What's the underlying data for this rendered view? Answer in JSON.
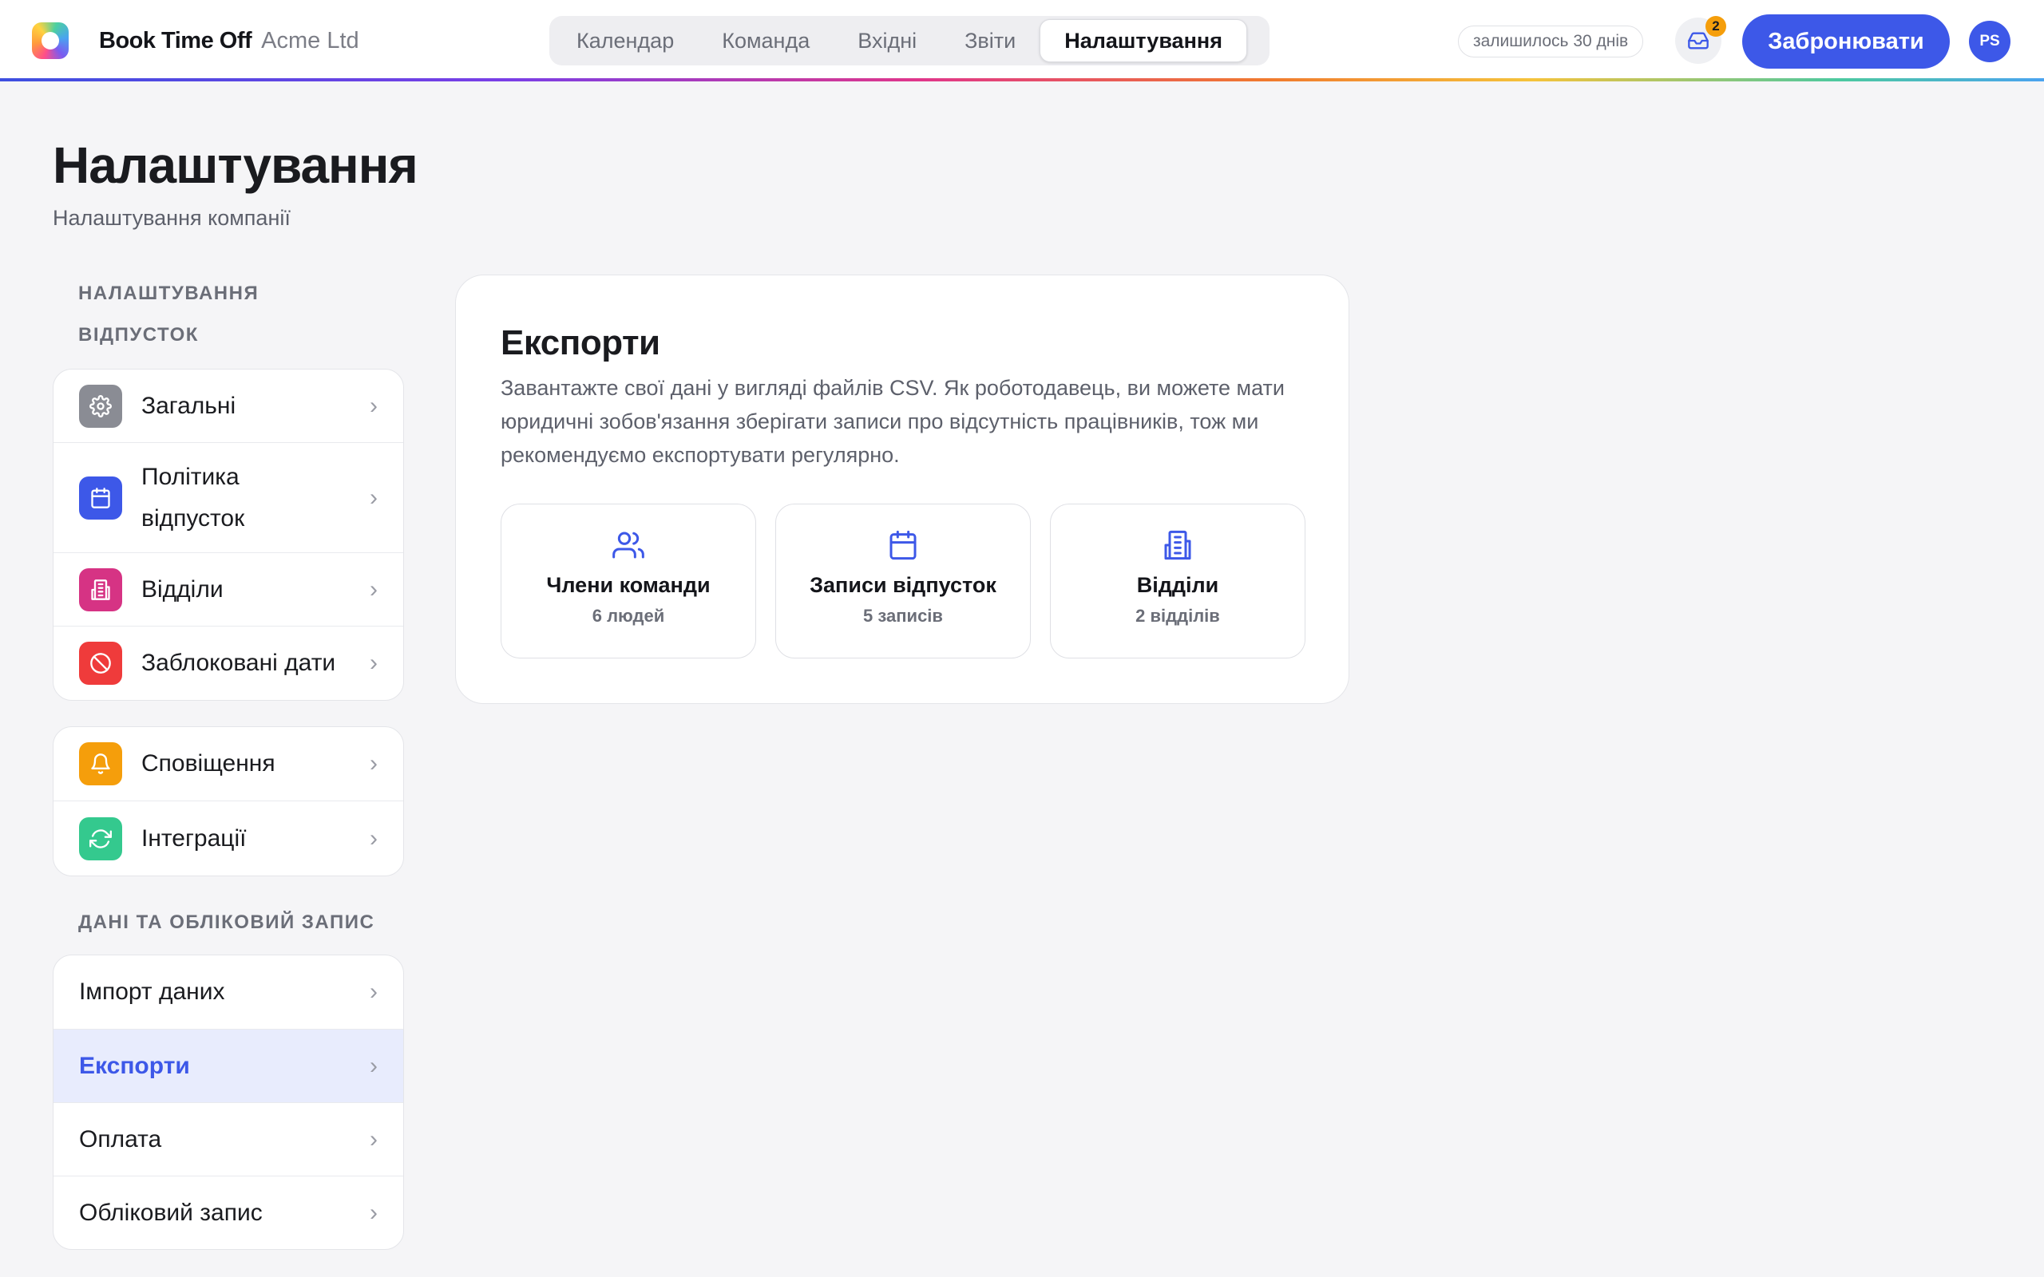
{
  "app": {
    "name": "Book Time Off",
    "company": "Acme Ltd"
  },
  "nav": {
    "tabs": [
      {
        "label": "Календар"
      },
      {
        "label": "Команда"
      },
      {
        "label": "Вхідні"
      },
      {
        "label": "Звіти"
      },
      {
        "label": "Налаштування",
        "active": true
      }
    ]
  },
  "header": {
    "days_left": "залишилось 30 днів",
    "inbox_count": "2",
    "book_label": "Забронювати",
    "avatar_initials": "PS"
  },
  "page": {
    "title": "Налаштування",
    "subtitle": "Налаштування компанії"
  },
  "sidebar": {
    "leave_section_line1": "НАЛАШТУВАННЯ",
    "leave_section_line2": "ВІДПУСТОК",
    "leave_items": [
      {
        "label": "Загальні",
        "icon": "gear-icon",
        "color": "#8a8c94"
      },
      {
        "label_line1": "Політика",
        "label_line2": "відпусток",
        "icon": "calendar-icon",
        "color": "#3d58e8"
      },
      {
        "label": "Відділи",
        "icon": "building-icon",
        "color": "#d63384"
      },
      {
        "label": "Заблоковані дати",
        "icon": "blocked-icon",
        "color": "#ef3b3b"
      }
    ],
    "other_items": [
      {
        "label": "Сповіщення",
        "icon": "bell-icon",
        "color": "#f59e0b"
      },
      {
        "label": "Інтеграції",
        "icon": "sync-icon",
        "color": "#34c98e"
      }
    ],
    "data_section": "ДАНІ ТА ОБЛІКОВИЙ ЗАПИС",
    "data_items": [
      {
        "label": "Імпорт даних"
      },
      {
        "label": "Експорти",
        "active": true
      },
      {
        "label": "Оплата"
      },
      {
        "label": "Обліковий запис"
      }
    ]
  },
  "main": {
    "title": "Експорти",
    "description": "Завантажте свої дані у вигляді файлів CSV. Як роботодавець, ви можете мати юридичні зобов'язання зберігати записи про відсутність працівників, тож ми рекомендуємо експортувати регулярно.",
    "exports": [
      {
        "title": "Члени команди",
        "count": "6 людей",
        "icon": "users-icon"
      },
      {
        "title": "Записи відпусток",
        "count": "5 записів",
        "icon": "calendar-icon"
      },
      {
        "title": "Відділи",
        "count": "2 відділів",
        "icon": "building-icon"
      }
    ]
  },
  "colors": {
    "accent": "#3d58e8",
    "active_bg": "#e8ecfd",
    "badge": "#f59e0b"
  }
}
